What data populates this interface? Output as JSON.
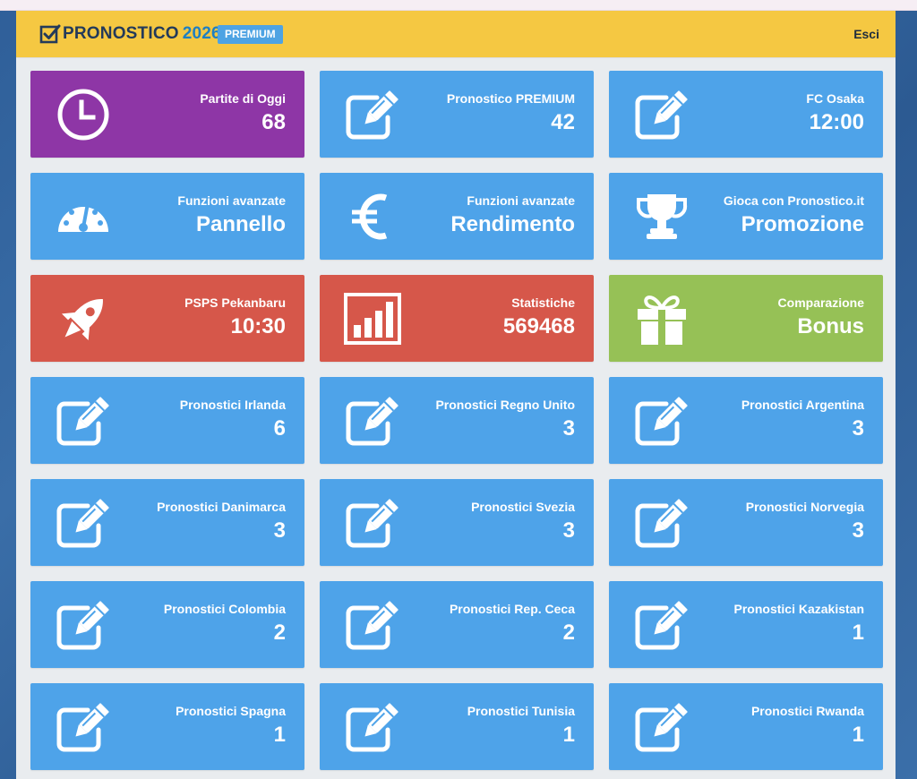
{
  "header": {
    "logo_main": "PRONOSTICO",
    "logo_year": "2026",
    "badge": "PREMIUM",
    "exit_label": "Esci"
  },
  "colors": {
    "header": "#f5c842",
    "blue": "#4ea3e9",
    "purple": "#8e36a6",
    "red": "#d6574a",
    "green": "#96c156"
  },
  "tiles": [
    {
      "label": "Partite di Oggi",
      "value": "68",
      "icon": "clock-icon",
      "color": "purple"
    },
    {
      "label": "Pronostico PREMIUM",
      "value": "42",
      "icon": "edit-icon",
      "color": "blue"
    },
    {
      "label": "FC Osaka",
      "value": "12:00",
      "icon": "edit-icon",
      "color": "blue"
    },
    {
      "label": "Funzioni avanzate",
      "value": "Pannello",
      "icon": "dashboard-icon",
      "color": "blue"
    },
    {
      "label": "Funzioni avanzate",
      "value": "Rendimento",
      "icon": "euro-icon",
      "color": "blue"
    },
    {
      "label": "Gioca con Pronostico.it",
      "value": "Promozione",
      "icon": "trophy-icon",
      "color": "blue"
    },
    {
      "label": "PSPS Pekanbaru",
      "value": "10:30",
      "icon": "rocket-icon",
      "color": "red"
    },
    {
      "label": "Statistiche",
      "value": "569468",
      "icon": "bar-chart-icon",
      "color": "red"
    },
    {
      "label": "Comparazione",
      "value": "Bonus",
      "icon": "gift-icon",
      "color": "green"
    },
    {
      "label": "Pronostici Irlanda",
      "value": "6",
      "icon": "edit-icon",
      "color": "blue"
    },
    {
      "label": "Pronostici Regno Unito",
      "value": "3",
      "icon": "edit-icon",
      "color": "blue"
    },
    {
      "label": "Pronostici Argentina",
      "value": "3",
      "icon": "edit-icon",
      "color": "blue"
    },
    {
      "label": "Pronostici Danimarca",
      "value": "3",
      "icon": "edit-icon",
      "color": "blue"
    },
    {
      "label": "Pronostici Svezia",
      "value": "3",
      "icon": "edit-icon",
      "color": "blue"
    },
    {
      "label": "Pronostici Norvegia",
      "value": "3",
      "icon": "edit-icon",
      "color": "blue"
    },
    {
      "label": "Pronostici Colombia",
      "value": "2",
      "icon": "edit-icon",
      "color": "blue"
    },
    {
      "label": "Pronostici Rep. Ceca",
      "value": "2",
      "icon": "edit-icon",
      "color": "blue"
    },
    {
      "label": "Pronostici Kazakistan",
      "value": "1",
      "icon": "edit-icon",
      "color": "blue"
    },
    {
      "label": "Pronostici Spagna",
      "value": "1",
      "icon": "edit-icon",
      "color": "blue"
    },
    {
      "label": "Pronostici Tunisia",
      "value": "1",
      "icon": "edit-icon",
      "color": "blue"
    },
    {
      "label": "Pronostici Rwanda",
      "value": "1",
      "icon": "edit-icon",
      "color": "blue"
    }
  ]
}
